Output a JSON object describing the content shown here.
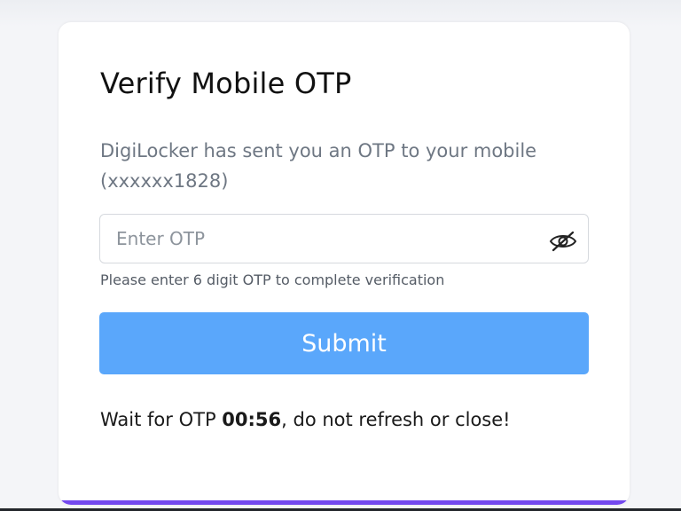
{
  "card": {
    "title": "Verify Mobile OTP",
    "subtitle": "DigiLocker has sent you an OTP to your mobile (xxxxxx1828)",
    "otp_input": {
      "placeholder": "Enter OTP",
      "value": "",
      "toggle_icon": "eye-slash-icon"
    },
    "hint": "Please enter 6 digit OTP to complete verification",
    "submit_label": "Submit",
    "wait": {
      "prefix": "Wait for OTP ",
      "timer": "00:56",
      "suffix": ", do not refresh or close!"
    }
  },
  "colors": {
    "accent": "#7348ee",
    "button": "#5aa7fb",
    "button_text": "#ffffff",
    "subtitle": "#6e7783"
  }
}
